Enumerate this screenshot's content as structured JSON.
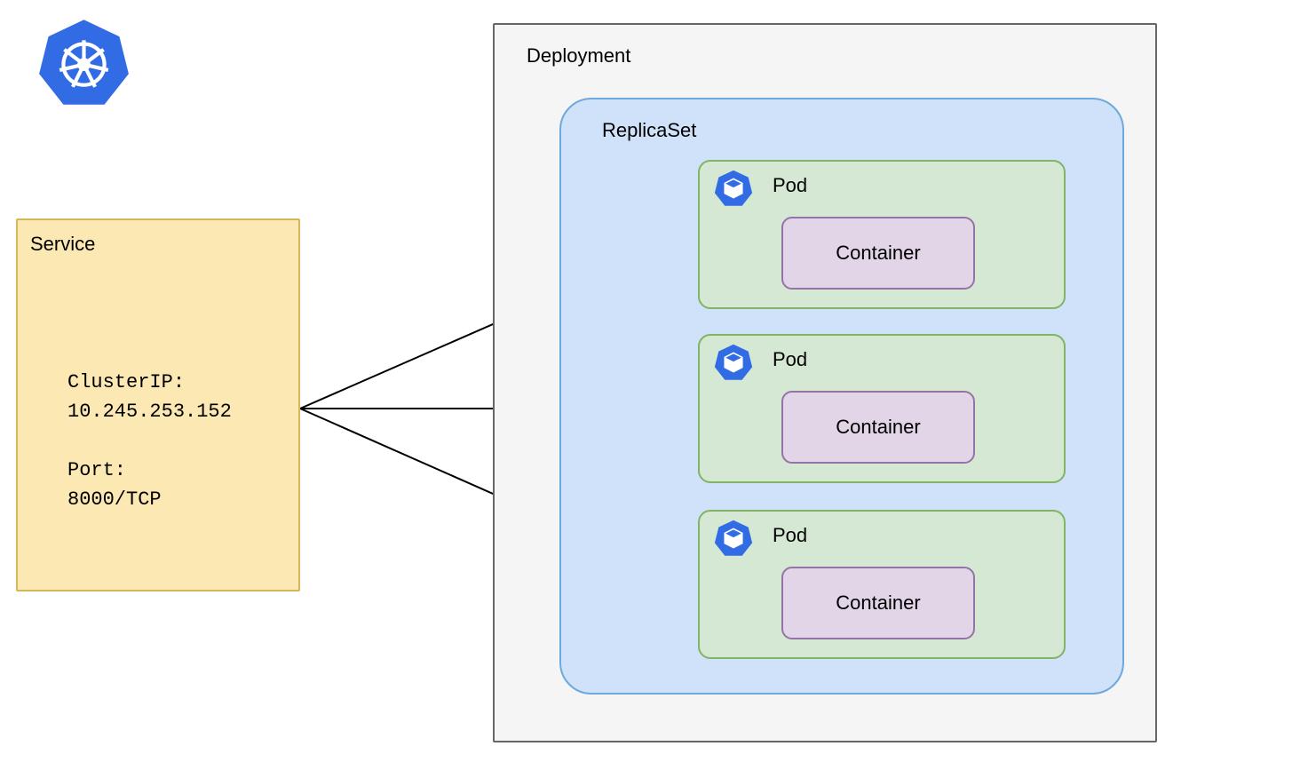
{
  "logo": {
    "name": "kubernetes-logo-icon"
  },
  "service": {
    "title": "Service",
    "details": "ClusterIP:\n10.245.253.152\n\nPort:\n8000/TCP",
    "cluster_ip_label": "ClusterIP:",
    "cluster_ip": "10.245.253.152",
    "port_label": "Port:",
    "port": "8000/TCP"
  },
  "deployment": {
    "title": "Deployment",
    "replicaset": {
      "title": "ReplicaSet",
      "pods": [
        {
          "title": "Pod",
          "container": "Container"
        },
        {
          "title": "Pod",
          "container": "Container"
        },
        {
          "title": "Pod",
          "container": "Container"
        }
      ]
    }
  },
  "colors": {
    "service_fill": "#fbe8b2",
    "service_stroke": "#d7b559",
    "deployment_fill": "#f5f5f5",
    "deployment_stroke": "#666666",
    "replicaset_fill": "#d0e2f9",
    "replicaset_stroke": "#6fa8dc",
    "pod_fill": "#d5e8d4",
    "pod_stroke": "#82b366",
    "container_fill": "#e1d5e7",
    "container_stroke": "#9673a6",
    "k8s_blue": "#326ce5"
  },
  "diagram": {
    "connections": [
      {
        "from": "service",
        "to": "pod-1"
      },
      {
        "from": "service",
        "to": "pod-2"
      },
      {
        "from": "service",
        "to": "pod-3"
      }
    ]
  }
}
